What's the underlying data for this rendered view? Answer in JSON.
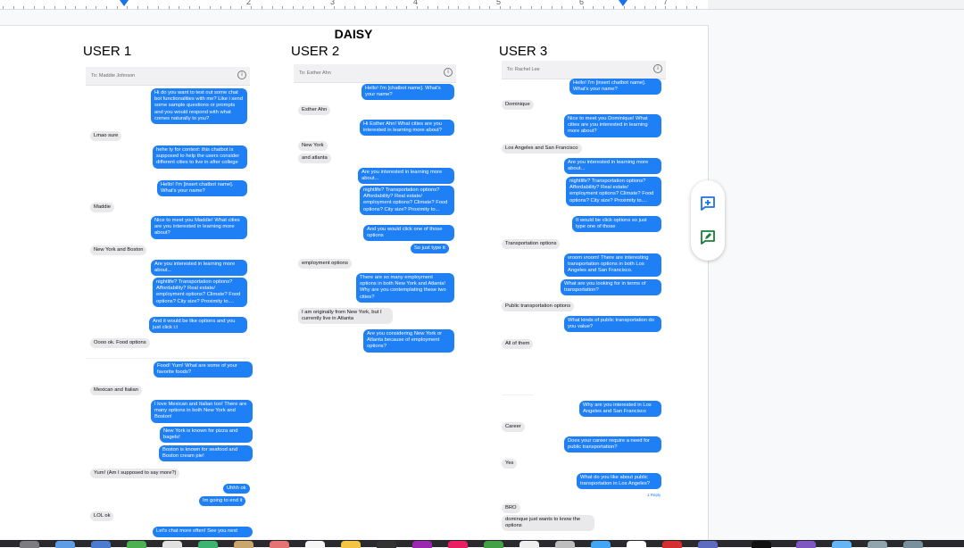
{
  "ruler": {
    "numbers": [
      "2",
      "3",
      "4",
      "5",
      "6",
      "7"
    ]
  },
  "doc": {
    "title": "DAISY"
  },
  "users": [
    {
      "heading": "USER 1",
      "to": "To: Maddie Johnson",
      "messages": [
        {
          "dir": "out",
          "text": "Hi do you want to test out some chat bot functionalities with me? Like i send some sample questions or prompts and you would respond with what comes naturally to you?"
        },
        {
          "dir": "in",
          "text": "Lmao sure"
        },
        {
          "dir": "out",
          "text": "hehe ty for context: this chatbot is supposed to help the users consider different cities to live in after college"
        },
        {
          "dir": "out",
          "text": "Hello! I'm [insert chatbot name]. What's your name?"
        },
        {
          "dir": "in",
          "text": "Maddie"
        },
        {
          "dir": "out",
          "text": "Nice to meet you Maddie! What cities are you interested in learning more about?"
        },
        {
          "dir": "in",
          "text": "New York and Boston"
        },
        {
          "dir": "out",
          "text": "Are you interested in learning more about..."
        },
        {
          "dir": "out",
          "text": "nightlife? Transportation options? Affordability? Real estate/ employment options? Climate? Food options? City size? Proximity to...."
        },
        {
          "dir": "out",
          "text": "And it would be like options and you just click i.t"
        },
        {
          "dir": "in",
          "text": "Oooo ok. Food options"
        },
        {
          "dir": "out",
          "text": "Food! Yum! What are some of your favorite foods?"
        },
        {
          "dir": "in",
          "text": "Mexican and Italian"
        },
        {
          "dir": "out",
          "text": "I love Mexican and Italian too! There are many options in both New York and Boston!"
        },
        {
          "dir": "out",
          "text": "New York is known for pizza and bagels!"
        },
        {
          "dir": "out",
          "text": "Boston is known for seafood and Boston cream pie!"
        },
        {
          "dir": "in",
          "text": "Yum! (Am I supposed to say more?)"
        },
        {
          "dir": "out",
          "text": "Uhhh ok"
        },
        {
          "dir": "out",
          "text": "Im going to end it"
        },
        {
          "dir": "in",
          "text": "LOL ok"
        },
        {
          "dir": "out",
          "text": "Let's chat more often! See you next"
        }
      ]
    },
    {
      "heading": "USER 2",
      "to": "To: Esther Ahn",
      "messages": [
        {
          "dir": "out",
          "text": "Hello! I'm [chatbot name]. What's your name?"
        },
        {
          "dir": "in",
          "text": "Esther Ahn"
        },
        {
          "dir": "out",
          "text": "Hi Esther Ahn! What cities are you interested in learning more about?"
        },
        {
          "dir": "in",
          "text": "New York"
        },
        {
          "dir": "in",
          "text": "and atlanta"
        },
        {
          "dir": "out",
          "text": "Are you interested in learning more about..."
        },
        {
          "dir": "out",
          "text": "nightlife? Transportation options? Affordability? Real estate/ employment options? Climate? Food options? City size? Proximity to..."
        },
        {
          "dir": "out",
          "text": "And you would click one of those options"
        },
        {
          "dir": "out",
          "text": "So just type it"
        },
        {
          "dir": "in",
          "text": "employment options"
        },
        {
          "dir": "out",
          "text": "There are so many employment options in both New York and Atlanta! Why are you contemplating these two cities?"
        },
        {
          "dir": "in",
          "text": "I am originally from New York, but I currently live in Atlanta"
        },
        {
          "dir": "out",
          "text": "Are you considering New York or Atlanta because of employment options?"
        }
      ]
    },
    {
      "heading": "USER 3",
      "to": "To: Rachel Lee",
      "messages": [
        {
          "dir": "out",
          "text": "Hello! I'm [insert chatbot name]. What's your name?"
        },
        {
          "dir": "in",
          "text": "Dominique"
        },
        {
          "dir": "out",
          "text": "Nice to meet you Dominique! What cities are you interested in learning more about?"
        },
        {
          "dir": "in",
          "text": "Los Angeles and San Francisco"
        },
        {
          "dir": "out",
          "text": "Are you interested in learning more about..."
        },
        {
          "dir": "out",
          "text": "nightlife? Transportation options? Affordability? Real estate/ employment options? Climate? Food options? City size? Proximity to...."
        },
        {
          "dir": "out",
          "text": "It would be click options so just type one of those"
        },
        {
          "dir": "in",
          "text": "Transportation options"
        },
        {
          "dir": "out",
          "text": "vroom vroom! There are interesting transportation options in both Los Angeles and San Francisco."
        },
        {
          "dir": "out",
          "text": "What are you looking for in terms of transportation?"
        },
        {
          "dir": "in",
          "text": "Public transportation options"
        },
        {
          "dir": "out",
          "text": "What kinds of public transportation do you value?"
        },
        {
          "dir": "in",
          "text": "All of them"
        },
        {
          "dir": "out",
          "text": "Why are you interested in Los Angeles and San Francisco"
        },
        {
          "dir": "in",
          "text": "Career"
        },
        {
          "dir": "out",
          "text": "Does your career require a need for public transportation?"
        },
        {
          "dir": "in",
          "text": "Yes"
        },
        {
          "dir": "out",
          "text": "What do you like about public transportation in Los Angeles?"
        },
        {
          "dir": "reply",
          "text": "1 Reply"
        },
        {
          "dir": "in",
          "text": "BRO"
        },
        {
          "dir": "in",
          "text": "dominque just wants to know the options"
        }
      ]
    }
  ],
  "side_panel": {
    "buttons": [
      {
        "icon": "add-comment-icon",
        "color": "#1a73e8"
      },
      {
        "icon": "suggest-edit-icon",
        "color": "#188038"
      }
    ]
  }
}
